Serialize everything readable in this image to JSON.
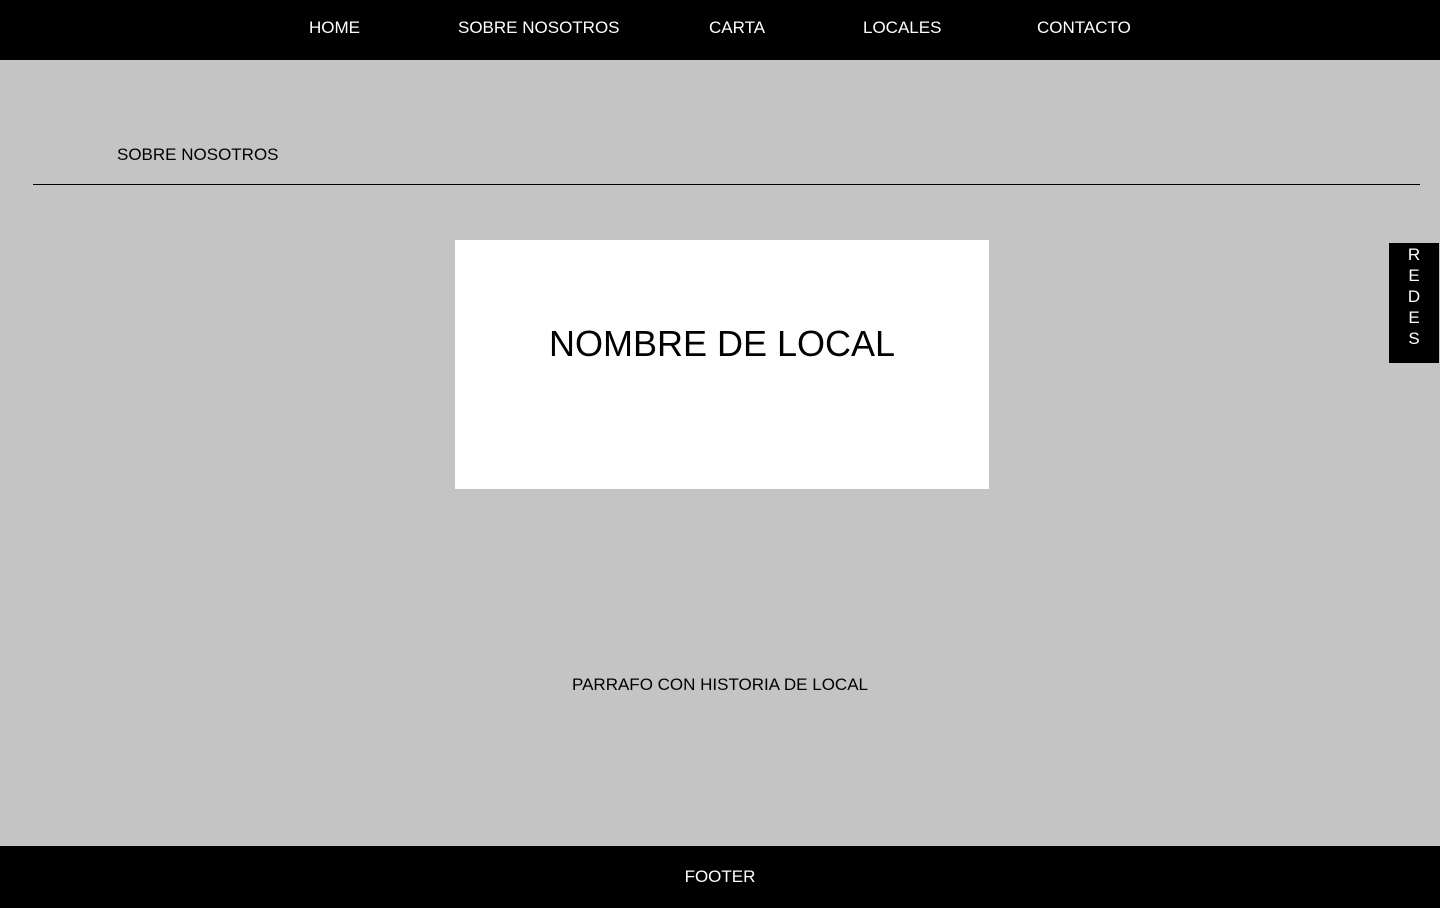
{
  "nav": {
    "items": [
      {
        "label": "HOME"
      },
      {
        "label": "SOBRE NOSOTROS"
      },
      {
        "label": "CARTA"
      },
      {
        "label": "LOCALES"
      },
      {
        "label": "CONTACTO"
      }
    ]
  },
  "section": {
    "title": "SOBRE NOSOTROS"
  },
  "local": {
    "name": "NOMBRE DE LOCAL",
    "history": "PARRAFO CON HISTORIA DE LOCAL"
  },
  "redes": {
    "label": "REDES",
    "letters": [
      "R",
      "E",
      "D",
      "E",
      "S"
    ]
  },
  "footer": {
    "label": "FOOTER"
  },
  "colors": {
    "background": "#c4c4c4",
    "bar": "#000000",
    "card": "#ffffff",
    "text_light": "#ffffff",
    "text_dark": "#000000"
  }
}
